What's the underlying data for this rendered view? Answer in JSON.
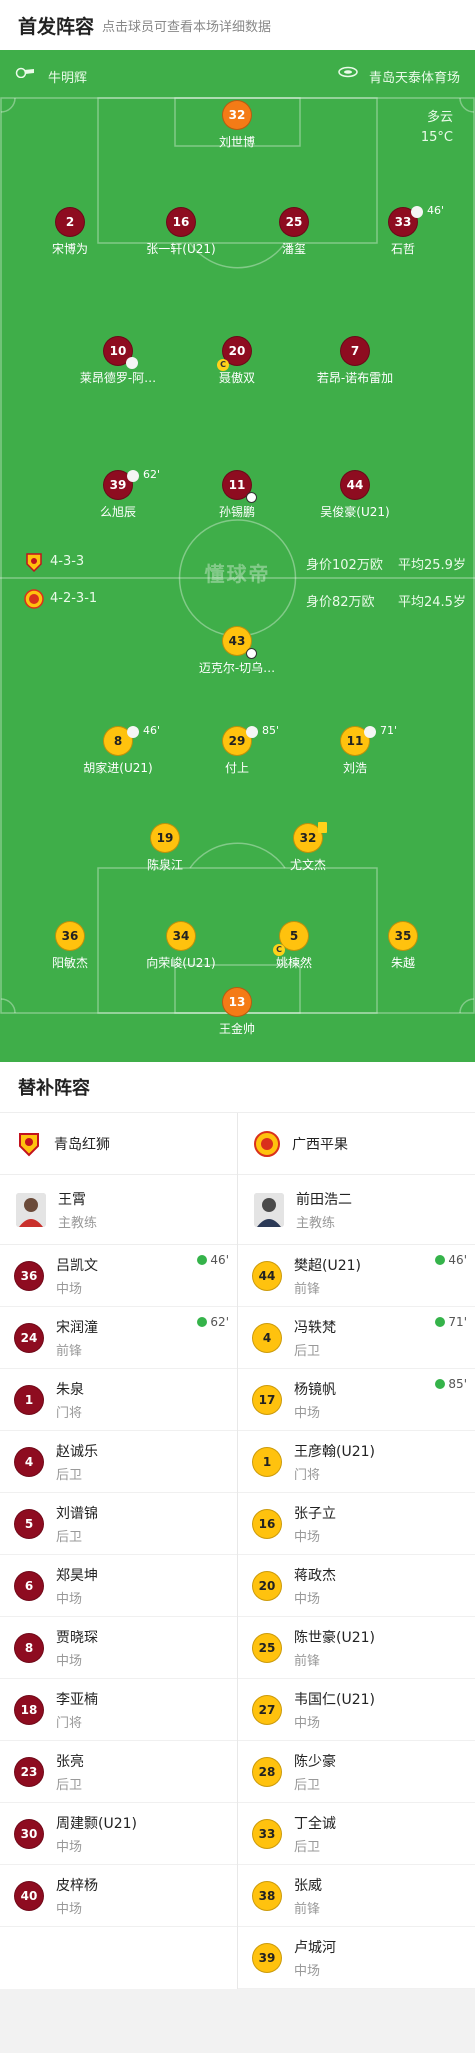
{
  "header": {
    "title": "首发阵容",
    "subtitle": "点击球员可查看本场详细数据"
  },
  "pitch": {
    "referee": "牛明辉",
    "stadium": "青岛天泰体育场",
    "weather": "多云",
    "temperature": "15°C",
    "watermark": "懂球帝",
    "home": {
      "formation": "4-3-3",
      "value": "身价102万欧",
      "avg_age": "平均25.9岁"
    },
    "away": {
      "formation": "4-2-3-1",
      "value": "身价82万欧",
      "avg_age": "平均24.5岁"
    }
  },
  "home_lineup": [
    {
      "num": "32",
      "name": "刘世博",
      "gk": true
    },
    {
      "num": "2",
      "name": "宋博为"
    },
    {
      "num": "16",
      "name": "张一轩(U21)"
    },
    {
      "num": "25",
      "name": "潘玺"
    },
    {
      "num": "33",
      "name": "石哲",
      "sub_min": "46'"
    },
    {
      "num": "10",
      "name": "莱昂德罗-阿…"
    },
    {
      "num": "20",
      "name": "聂傲双"
    },
    {
      "num": "7",
      "name": "若昂-诺布雷加"
    },
    {
      "num": "39",
      "name": "么旭辰",
      "sub_min": "62'"
    },
    {
      "num": "11",
      "name": "孙锡鹏"
    },
    {
      "num": "44",
      "name": "吴俊豪(U21)"
    }
  ],
  "away_lineup": [
    {
      "num": "43",
      "name": "迈克尔-切乌…"
    },
    {
      "num": "8",
      "name": "胡家进(U21)",
      "sub_min": "46'"
    },
    {
      "num": "29",
      "name": "付上",
      "sub_min": "85'"
    },
    {
      "num": "11",
      "name": "刘浩",
      "sub_min": "71'"
    },
    {
      "num": "19",
      "name": "陈泉江"
    },
    {
      "num": "32",
      "name": "尤文杰"
    },
    {
      "num": "36",
      "name": "阳敏杰"
    },
    {
      "num": "34",
      "name": "向荣峻(U21)"
    },
    {
      "num": "5",
      "name": "姚楝然"
    },
    {
      "num": "35",
      "name": "朱越"
    },
    {
      "num": "13",
      "name": "王金帅",
      "gk": true
    }
  ],
  "subs_title": "替补阵容",
  "home_team": {
    "name": "青岛红狮",
    "coach": {
      "name": "王霄",
      "role": "主教练"
    },
    "subs": [
      {
        "num": "36",
        "name": "吕凯文",
        "pos": "中场",
        "in": "46'"
      },
      {
        "num": "24",
        "name": "宋润潼",
        "pos": "前锋",
        "in": "62'"
      },
      {
        "num": "1",
        "name": "朱泉",
        "pos": "门将"
      },
      {
        "num": "4",
        "name": "赵诚乐",
        "pos": "后卫"
      },
      {
        "num": "5",
        "name": "刘谱锦",
        "pos": "后卫"
      },
      {
        "num": "6",
        "name": "郑昊坤",
        "pos": "中场"
      },
      {
        "num": "8",
        "name": "贾晓琛",
        "pos": "中场"
      },
      {
        "num": "18",
        "name": "李亚楠",
        "pos": "门将"
      },
      {
        "num": "23",
        "name": "张亮",
        "pos": "后卫"
      },
      {
        "num": "30",
        "name": "周建颢(U21)",
        "pos": "中场"
      },
      {
        "num": "40",
        "name": "皮梓杨",
        "pos": "中场"
      }
    ]
  },
  "away_team": {
    "name": "广西平果",
    "coach": {
      "name": "前田浩二",
      "role": "主教练"
    },
    "subs": [
      {
        "num": "44",
        "name": "樊超(U21)",
        "pos": "前锋",
        "in": "46'"
      },
      {
        "num": "4",
        "name": "冯轶梵",
        "pos": "后卫",
        "in": "71'"
      },
      {
        "num": "17",
        "name": "杨镜帆",
        "pos": "中场",
        "in": "85'"
      },
      {
        "num": "1",
        "name": "王彦翰(U21)",
        "pos": "门将"
      },
      {
        "num": "16",
        "name": "张子立",
        "pos": "中场"
      },
      {
        "num": "20",
        "name": "蒋政杰",
        "pos": "中场"
      },
      {
        "num": "25",
        "name": "陈世豪(U21)",
        "pos": "前锋"
      },
      {
        "num": "27",
        "name": "韦国仁(U21)",
        "pos": "中场"
      },
      {
        "num": "28",
        "name": "陈少豪",
        "pos": "后卫"
      },
      {
        "num": "33",
        "name": "丁全诚",
        "pos": "后卫"
      },
      {
        "num": "38",
        "name": "张威",
        "pos": "前锋"
      },
      {
        "num": "39",
        "name": "卢城河",
        "pos": "中场"
      }
    ]
  },
  "colors": {
    "pitch": "#3fae49",
    "home": "#8e0c20",
    "away": "#ffc20e",
    "gk": "#f47b16"
  }
}
